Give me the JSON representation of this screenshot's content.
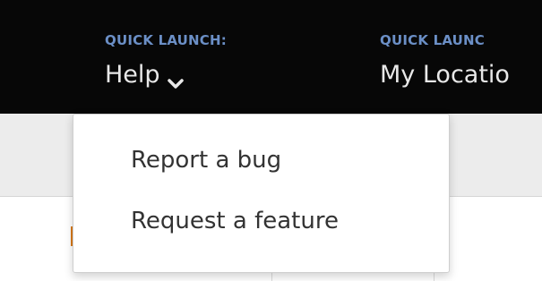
{
  "quick_launch": [
    {
      "label": "QUICK LAUNCH:",
      "value": "Help"
    },
    {
      "label": "QUICK LAUNC",
      "value": "My Locatio"
    }
  ],
  "dropdown": {
    "items": [
      "Report a bug",
      "Request a feature"
    ]
  },
  "colors": {
    "topbar": "#070707",
    "label": "#6b8fc6",
    "value": "#e8e8e8",
    "subbar": "#ececec",
    "accent": "#d97a1a"
  }
}
